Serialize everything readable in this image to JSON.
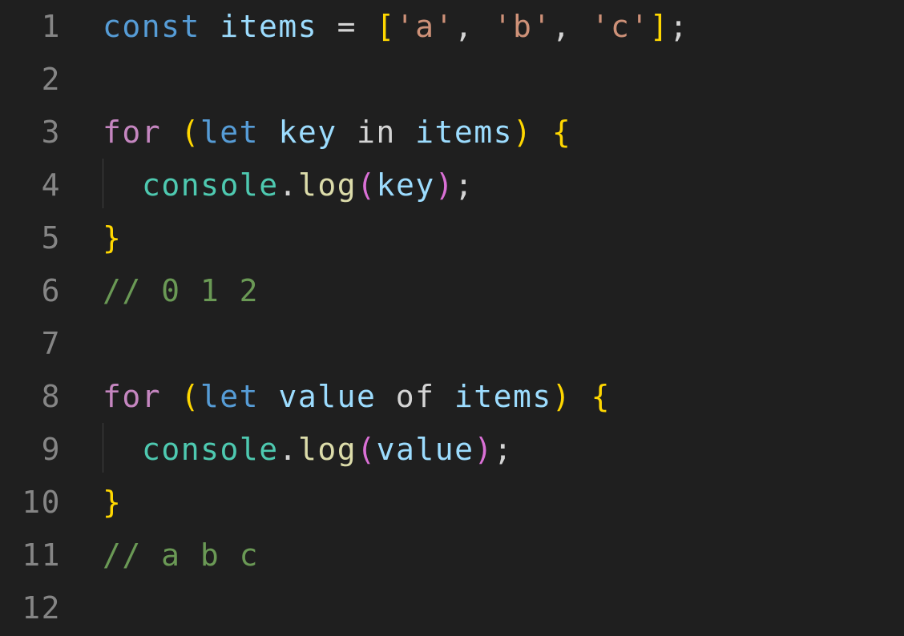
{
  "editor": {
    "line_numbers": [
      "1",
      "2",
      "3",
      "4",
      "5",
      "6",
      "7",
      "8",
      "9",
      "10",
      "11",
      "12"
    ],
    "lines": {
      "l1": {
        "kw": "const",
        "name": "items",
        "eq": "=",
        "open": "[",
        "s1": "'a'",
        "c1": ",",
        "s2": "'b'",
        "c2": ",",
        "s3": "'c'",
        "close": "]",
        "semi": ";"
      },
      "l3": {
        "kw": "for",
        "open_paren": "(",
        "let": "let",
        "var": "key",
        "op": "in",
        "iter": "items",
        "close_paren": ")",
        "brace": "{"
      },
      "l4": {
        "obj": "console",
        "dot": ".",
        "fn": "log",
        "open": "(",
        "arg": "key",
        "close": ")",
        "semi": ";"
      },
      "l5": {
        "brace": "}"
      },
      "l6": {
        "comment": "// 0 1 2"
      },
      "l8": {
        "kw": "for",
        "open_paren": "(",
        "let": "let",
        "var": "value",
        "op": "of",
        "iter": "items",
        "close_paren": ")",
        "brace": "{"
      },
      "l9": {
        "obj": "console",
        "dot": ".",
        "fn": "log",
        "open": "(",
        "arg": "value",
        "close": ")",
        "semi": ";"
      },
      "l10": {
        "brace": "}"
      },
      "l11": {
        "comment": "// a b c"
      }
    }
  },
  "colors": {
    "background": "#1f1f1f",
    "line_number": "#858585",
    "keyword_declaration": "#569cd6",
    "keyword_control": "#c586c0",
    "variable": "#9cdcfe",
    "string": "#ce9178",
    "bracket_level1": "#ffd700",
    "bracket_level2": "#da70d6",
    "class": "#4ec9b0",
    "function": "#dcdcaa",
    "comment": "#6a9955"
  }
}
